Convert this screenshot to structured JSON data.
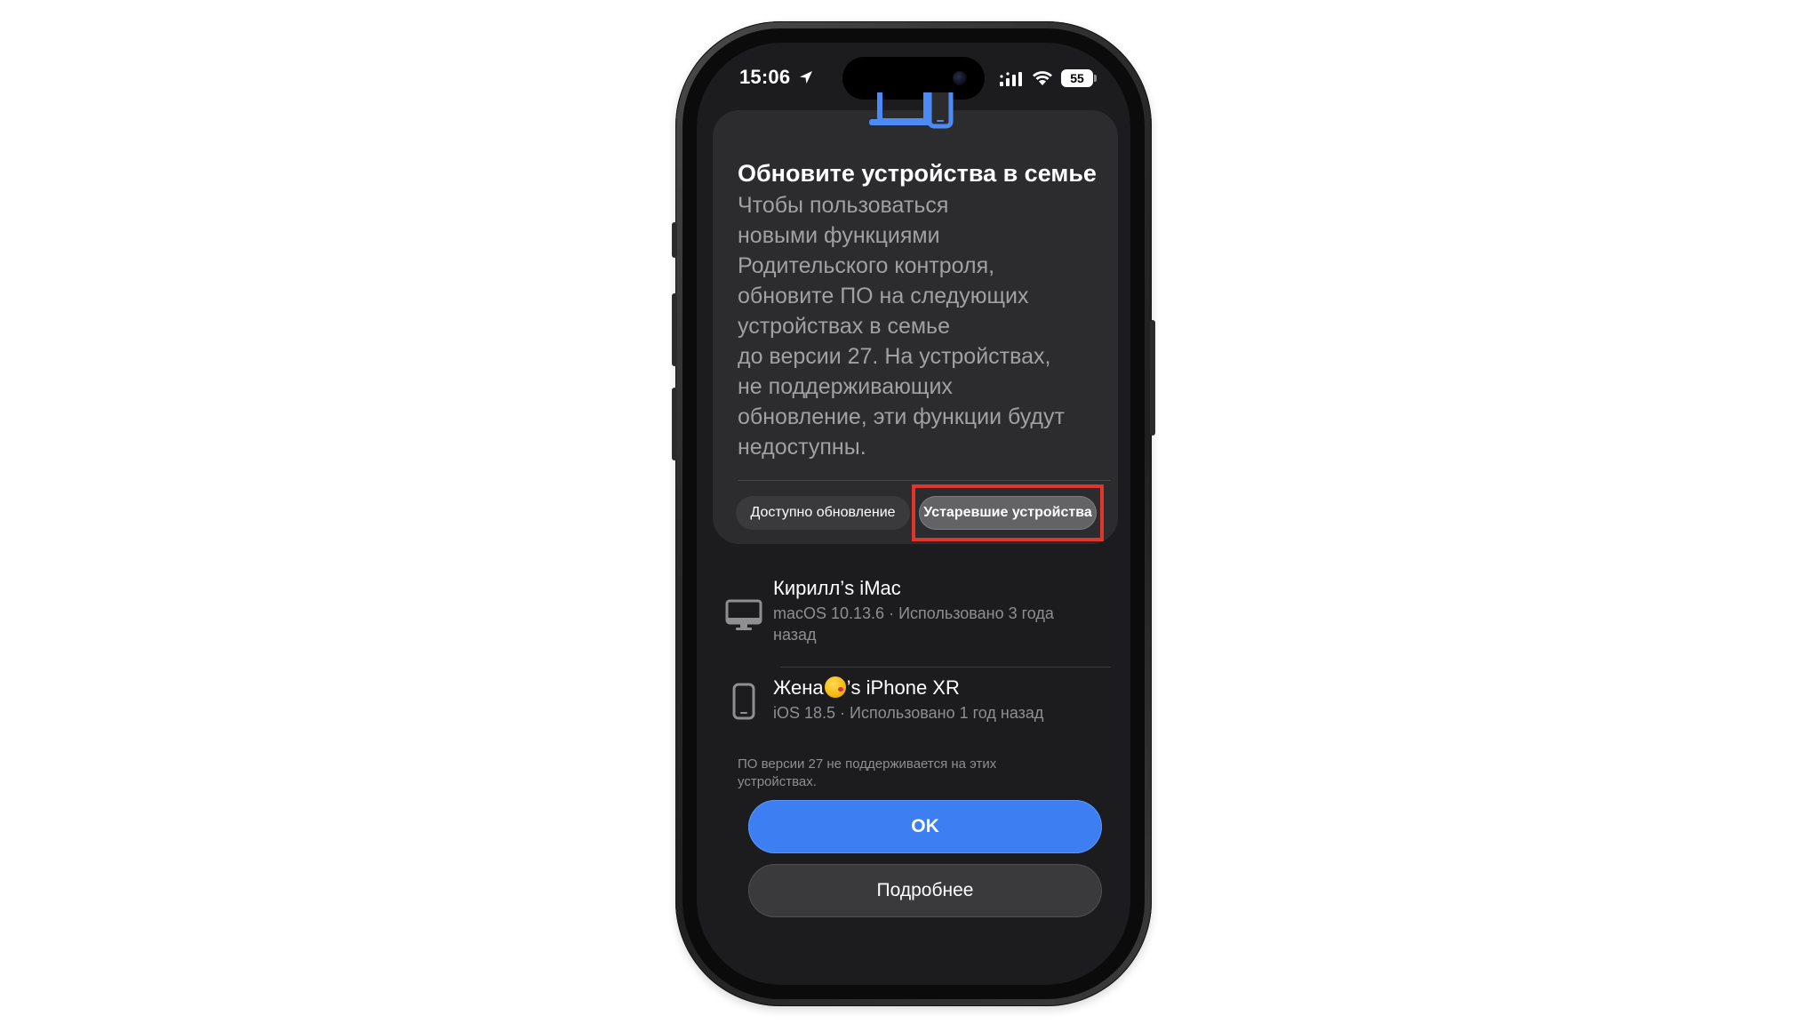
{
  "status_bar": {
    "time": "15:06",
    "battery": "55",
    "icons": [
      "location-arrow-icon",
      "cellular-signal-icon",
      "wifi-icon",
      "battery-icon"
    ]
  },
  "card": {
    "title": "Обновите устройства в семье",
    "body": "Чтобы пользоваться\nновыми функциями\nРодительского контроля,\nобновите ПО на следующих\nустройствах в семье\nдо версии 27. На устройствах,\nне поддерживающих\nобновление, эти функции будут\nнедоступны.",
    "segments": {
      "available": "Доступно обновление",
      "outdated": "Устаревшие устройства",
      "selected": "outdated"
    }
  },
  "devices": [
    {
      "name": "Кирилл’s iMac",
      "detail": "macOS 10.13.6 · Использовано 3 года\nназад",
      "icon": "imac-icon"
    },
    {
      "name_before_emoji": "Жена",
      "name_after_emoji": "’s iPhone XR",
      "emoji": "kissing-face-emoji",
      "detail": "iOS 18.5 · Использовано 1 год назад",
      "icon": "iphone-icon"
    }
  ],
  "footnote": "ПО версии 27 не поддерживается на этих\nустройствах.",
  "buttons": {
    "ok": "OK",
    "more": "Подробнее"
  },
  "colors": {
    "accent": "#3d7ff2",
    "highlight": "#e0352b",
    "sheet_bg": "#1c1c1e",
    "card_bg": "#2c2c2e"
  }
}
